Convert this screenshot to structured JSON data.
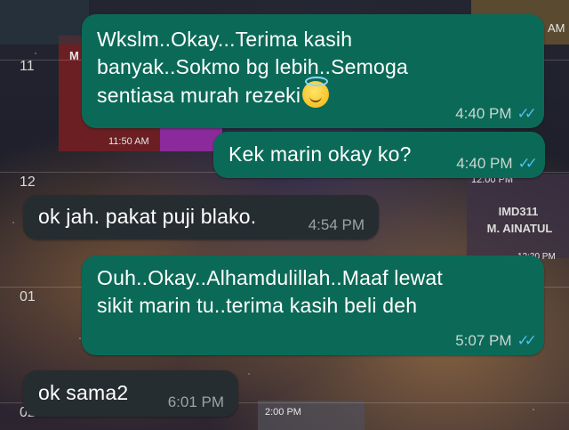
{
  "calendar": {
    "hours": [
      "11",
      "12",
      "01",
      "02"
    ],
    "time_tags": [
      "11:50 AM",
      "12:00 PM",
      "2:00 PM"
    ],
    "top_right_partial": "AM",
    "left_partial": "M",
    "event_code": "IMD311",
    "event_name": "M. AINATUL",
    "partial_bottom_tag": "12:30 PM",
    "colors": {
      "purple_block": "#8b2a9a",
      "maroon_block": "#6b1f22"
    }
  },
  "messages": [
    {
      "direction": "out",
      "text": "Wkslm..Okay...Terima kasih\nbanyak..Sokmo bg lebih..Semoga\nsentiasa murah rezeki",
      "emoji": "smiling-face-with-halo-emoji",
      "time": "4:40 PM",
      "status": "read"
    },
    {
      "direction": "out",
      "text": "Kek marin okay ko?",
      "time": "4:40 PM",
      "status": "read"
    },
    {
      "direction": "in",
      "text": "ok jah. pakat puji blako.",
      "time": "4:54 PM"
    },
    {
      "direction": "out",
      "text": "Ouh..Okay..Alhamdulillah..Maaf lewat\nsikit marin tu..terima kasih beli deh",
      "time": "5:07 PM",
      "status": "read"
    },
    {
      "direction": "in",
      "text": "ok sama2",
      "time": "6:01 PM"
    }
  ],
  "colors": {
    "outgoing_bubble": "#0b6a57",
    "incoming_bubble": "#262d31",
    "read_tick": "#53bdeb"
  }
}
